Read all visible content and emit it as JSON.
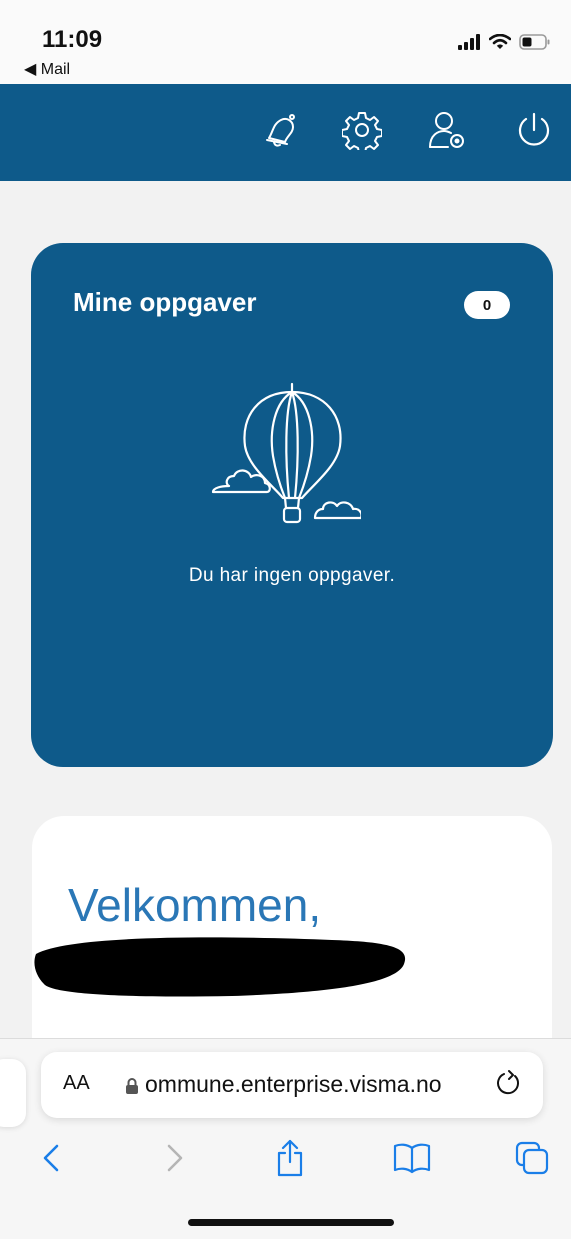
{
  "status_bar": {
    "time": "11:09",
    "back_app": "◀ Mail"
  },
  "header": {
    "icons": [
      "bell-icon",
      "settings-gear-icon",
      "user-settings-icon",
      "power-icon"
    ],
    "background": "#0e5a8a"
  },
  "tasks": {
    "title": "Mine oppgaver",
    "count": "0",
    "empty_message": "Du har ingen oppgaver.",
    "illustration": "hot-air-balloon-icon"
  },
  "welcome": {
    "title": "Velkommen,",
    "name_redacted": true,
    "accent": "#2a77b6"
  },
  "browser": {
    "aa_label": "AA",
    "url": "ommune.enterprise.visma.no",
    "accent": "#1a7ee8"
  }
}
